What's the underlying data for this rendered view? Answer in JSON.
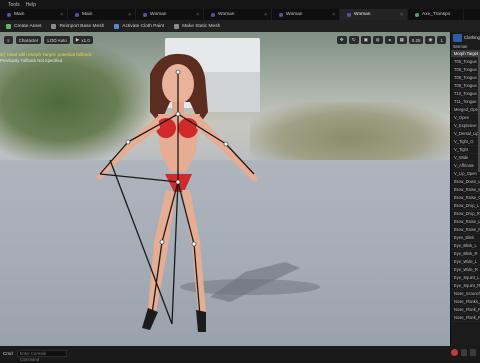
{
  "menu": {
    "items": [
      "Tools",
      "Help"
    ]
  },
  "tabs": [
    {
      "label": "Main",
      "active": false
    },
    {
      "label": "Main",
      "active": false
    },
    {
      "label": "Woman",
      "active": false
    },
    {
      "label": "Woman",
      "active": false
    },
    {
      "label": "Woman",
      "active": false
    },
    {
      "label": "Woman",
      "active": true
    },
    {
      "label": "Axe_Transpo",
      "active": false
    }
  ],
  "toolbar": {
    "create_asset": "Create Asset",
    "reimport": "Reimport Base Mesh",
    "activate_cloth": "Activate Cloth Paint",
    "static_mesh": "Make Static Mesh"
  },
  "viewport": {
    "char_label": "Character",
    "lod_label": "LOD Auto",
    "play_speed": "x1.0",
    "fov": "0.25",
    "grid": "1",
    "warning_line1": "9/) Used with Morph Target: potential fallback",
    "warning_line2": "Previously Fallback Not Specified"
  },
  "panel": {
    "title": "Clothing",
    "selection": "Woman",
    "items": [
      "Morph Target",
      "T05_Tongue",
      "T06_Tongue",
      "T08_Tongue",
      "T09_Tongue",
      "T10_Tongue",
      "T11_Tongue",
      "Merged_Open",
      "V_Open",
      "V_Explosive",
      "V_Dental_Lip",
      "V_Tight_O",
      "V_Tight",
      "V_Wide",
      "V_Affricate",
      "V_Lip_Open",
      "Brow_Down_Left",
      "Brow_Raise_Inner",
      "Brow_Raise_Outer",
      "Brow_Drop_L",
      "Brow_Drop_R",
      "Brow_Raise_L",
      "Brow_Raise_R",
      "Eyes_Blink",
      "Eye_Blink_L",
      "Eye_Blink_R",
      "Eye_Wide_L",
      "Eye_Wide_R",
      "Eye_Squint_L",
      "Eye_Squint_R",
      "Nose_Scrunch",
      "Nose_Flanks_Raise",
      "Nose_Flank_Raise_L",
      "Nose_Flank_Raise_R"
    ],
    "selected_index": 0
  },
  "status": {
    "cmd_label": "Cmd",
    "input_placeholder": "Enter Console Command"
  },
  "colors": {
    "accent": "#2e5ea8",
    "warning": "#e8d840",
    "record": "#c23b3b"
  }
}
